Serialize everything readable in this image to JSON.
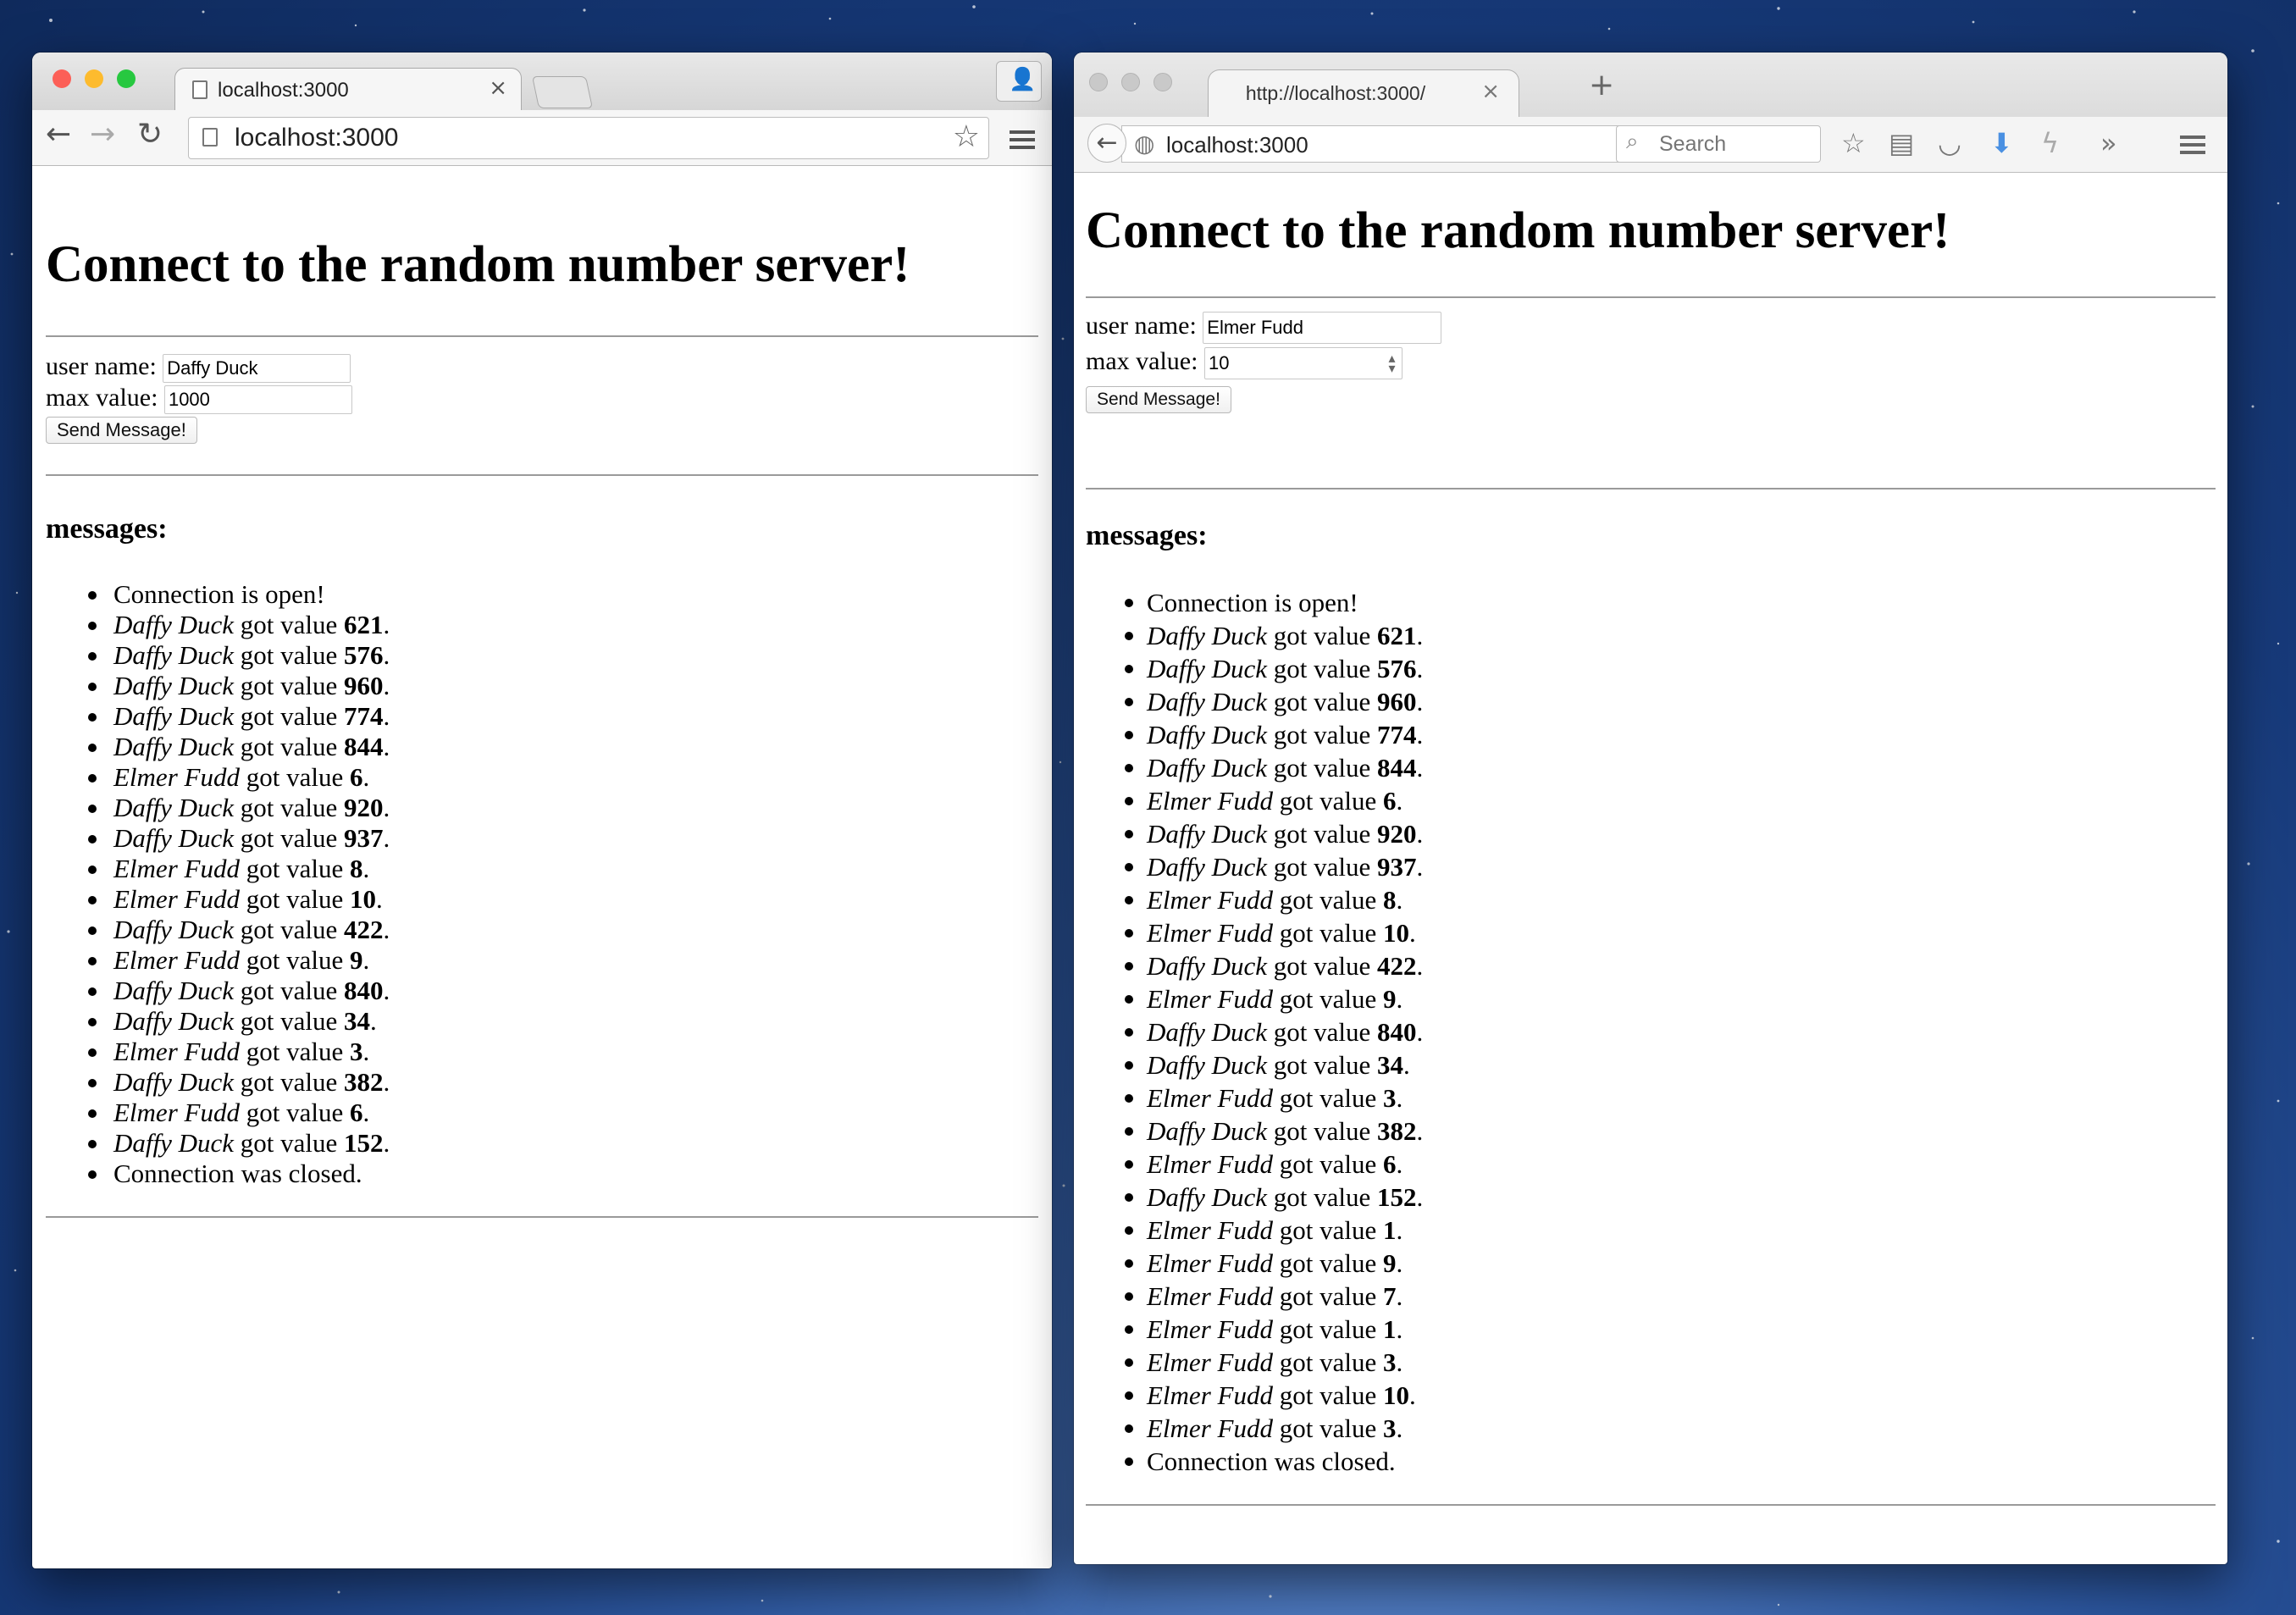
{
  "chrome": {
    "tab_title": "localhost:3000",
    "url": "localhost:3000",
    "heading": "Connect to the random number server!",
    "form": {
      "user_label": "user name:",
      "user_value": "Daffy Duck",
      "max_label": "max value:",
      "max_value": "1000",
      "send_label": "Send Message!"
    },
    "messages_heading": "messages:",
    "messages": [
      {
        "text": "Connection is open!"
      },
      {
        "who": "Daffy Duck",
        "mid": " got value ",
        "val": "621",
        "end": "."
      },
      {
        "who": "Daffy Duck",
        "mid": " got value ",
        "val": "576",
        "end": "."
      },
      {
        "who": "Daffy Duck",
        "mid": " got value ",
        "val": "960",
        "end": "."
      },
      {
        "who": "Daffy Duck",
        "mid": " got value ",
        "val": "774",
        "end": "."
      },
      {
        "who": "Daffy Duck",
        "mid": " got value ",
        "val": "844",
        "end": "."
      },
      {
        "who": "Elmer Fudd",
        "mid": " got value ",
        "val": "6",
        "end": "."
      },
      {
        "who": "Daffy Duck",
        "mid": " got value ",
        "val": "920",
        "end": "."
      },
      {
        "who": "Daffy Duck",
        "mid": " got value ",
        "val": "937",
        "end": "."
      },
      {
        "who": "Elmer Fudd",
        "mid": " got value ",
        "val": "8",
        "end": "."
      },
      {
        "who": "Elmer Fudd",
        "mid": " got value ",
        "val": "10",
        "end": "."
      },
      {
        "who": "Daffy Duck",
        "mid": " got value ",
        "val": "422",
        "end": "."
      },
      {
        "who": "Elmer Fudd",
        "mid": " got value ",
        "val": "9",
        "end": "."
      },
      {
        "who": "Daffy Duck",
        "mid": " got value ",
        "val": "840",
        "end": "."
      },
      {
        "who": "Daffy Duck",
        "mid": " got value ",
        "val": "34",
        "end": "."
      },
      {
        "who": "Elmer Fudd",
        "mid": " got value ",
        "val": "3",
        "end": "."
      },
      {
        "who": "Daffy Duck",
        "mid": " got value ",
        "val": "382",
        "end": "."
      },
      {
        "who": "Elmer Fudd",
        "mid": " got value ",
        "val": "6",
        "end": "."
      },
      {
        "who": "Daffy Duck",
        "mid": " got value ",
        "val": "152",
        "end": "."
      },
      {
        "text": "Connection was closed."
      }
    ]
  },
  "firefox": {
    "tab_title": "http://localhost:3000/",
    "url": "localhost:3000",
    "search_placeholder": "Search",
    "heading": "Connect to the random number server!",
    "form": {
      "user_label": "user name:",
      "user_value": "Elmer Fudd",
      "max_label": "max value:",
      "max_value": "10",
      "send_label": "Send Message!"
    },
    "messages_heading": "messages:",
    "messages": [
      {
        "text": "Connection is open!"
      },
      {
        "who": "Daffy Duck",
        "mid": " got value ",
        "val": "621",
        "end": "."
      },
      {
        "who": "Daffy Duck",
        "mid": " got value ",
        "val": "576",
        "end": "."
      },
      {
        "who": "Daffy Duck",
        "mid": " got value ",
        "val": "960",
        "end": "."
      },
      {
        "who": "Daffy Duck",
        "mid": " got value ",
        "val": "774",
        "end": "."
      },
      {
        "who": "Daffy Duck",
        "mid": " got value ",
        "val": "844",
        "end": "."
      },
      {
        "who": "Elmer Fudd",
        "mid": " got value ",
        "val": "6",
        "end": "."
      },
      {
        "who": "Daffy Duck",
        "mid": " got value ",
        "val": "920",
        "end": "."
      },
      {
        "who": "Daffy Duck",
        "mid": " got value ",
        "val": "937",
        "end": "."
      },
      {
        "who": "Elmer Fudd",
        "mid": " got value ",
        "val": "8",
        "end": "."
      },
      {
        "who": "Elmer Fudd",
        "mid": " got value ",
        "val": "10",
        "end": "."
      },
      {
        "who": "Daffy Duck",
        "mid": " got value ",
        "val": "422",
        "end": "."
      },
      {
        "who": "Elmer Fudd",
        "mid": " got value ",
        "val": "9",
        "end": "."
      },
      {
        "who": "Daffy Duck",
        "mid": " got value ",
        "val": "840",
        "end": "."
      },
      {
        "who": "Daffy Duck",
        "mid": " got value ",
        "val": "34",
        "end": "."
      },
      {
        "who": "Elmer Fudd",
        "mid": " got value ",
        "val": "3",
        "end": "."
      },
      {
        "who": "Daffy Duck",
        "mid": " got value ",
        "val": "382",
        "end": "."
      },
      {
        "who": "Elmer Fudd",
        "mid": " got value ",
        "val": "6",
        "end": "."
      },
      {
        "who": "Daffy Duck",
        "mid": " got value ",
        "val": "152",
        "end": "."
      },
      {
        "who": "Elmer Fudd",
        "mid": " got value ",
        "val": "1",
        "end": "."
      },
      {
        "who": "Elmer Fudd",
        "mid": " got value ",
        "val": "9",
        "end": "."
      },
      {
        "who": "Elmer Fudd",
        "mid": " got value ",
        "val": "7",
        "end": "."
      },
      {
        "who": "Elmer Fudd",
        "mid": " got value ",
        "val": "1",
        "end": "."
      },
      {
        "who": "Elmer Fudd",
        "mid": " got value ",
        "val": "3",
        "end": "."
      },
      {
        "who": "Elmer Fudd",
        "mid": " got value ",
        "val": "10",
        "end": "."
      },
      {
        "who": "Elmer Fudd",
        "mid": " got value ",
        "val": "3",
        "end": "."
      },
      {
        "text": "Connection was closed."
      }
    ]
  },
  "colors": {
    "close_red": "#fc5f57",
    "minimize_yellow": "#fdbb2e",
    "zoom_green": "#27c840",
    "firefox_download_blue": "#4a90e2"
  }
}
